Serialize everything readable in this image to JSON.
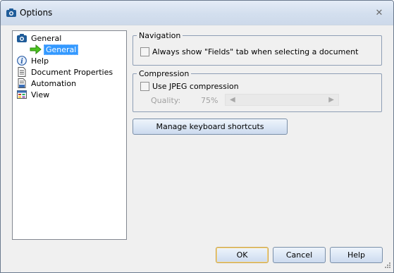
{
  "window": {
    "title": "Options",
    "close_glyph": "✕"
  },
  "tree": {
    "items": [
      {
        "label": "General",
        "icon": "camera-icon"
      },
      {
        "label": "General",
        "icon": "green-arrow-icon",
        "selected": true
      },
      {
        "label": "Help",
        "icon": "info-icon"
      },
      {
        "label": "Document Properties",
        "icon": "document-icon"
      },
      {
        "label": "Automation",
        "icon": "automation-icon"
      },
      {
        "label": "View",
        "icon": "view-icon"
      }
    ]
  },
  "navigation": {
    "legend": "Navigation",
    "always_show_fields_label": "Always show \"Fields\" tab when selecting a document",
    "always_show_fields_checked": false
  },
  "compression": {
    "legend": "Compression",
    "use_jpeg_label": "Use JPEG compression",
    "use_jpeg_checked": false,
    "quality_label": "Quality:",
    "quality_value": "75%"
  },
  "buttons": {
    "manage_shortcuts": "Manage keyboard shortcuts",
    "ok": "OK",
    "cancel": "Cancel",
    "help": "Help"
  },
  "colors": {
    "selection": "#3399ff",
    "title_gradient_top": "#e4ecf7"
  }
}
